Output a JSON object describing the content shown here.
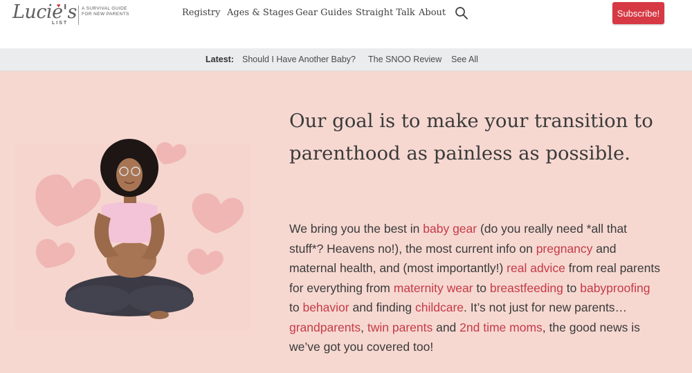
{
  "header": {
    "logo": {
      "script": "Lucie's",
      "list": "LIST",
      "tagline": "A SURVIVAL GUIDE FOR NEW PARENTS"
    },
    "nav": [
      {
        "label": "Registry"
      },
      {
        "label": "Ages & Stages"
      },
      {
        "label": "Gear Guides"
      },
      {
        "label": "Straight Talk"
      },
      {
        "label": "About"
      }
    ],
    "search_icon": "search-icon",
    "subscribe_label": "Subscribe!"
  },
  "latest": {
    "label": "Latest:",
    "links": [
      {
        "label": "Should I Have Another Baby?"
      },
      {
        "label": "The SNOO Review"
      },
      {
        "label": "See All"
      }
    ]
  },
  "hero": {
    "headline": "Our goal is to make your transition to parenthood as painless as possible.",
    "body": {
      "t1": "We bring you the best in ",
      "link_baby_gear": "baby gear",
      "t2": " (do you really need *all that stuff*? Heavens no!), the most current info on ",
      "link_pregnancy": "pregnancy",
      "t3": " and maternal health, and (most importantly!) ",
      "link_real_advice": "real advice",
      "t4": " from real parents for everything from ",
      "link_maternity_wear": "maternity wear",
      "t5": " to ",
      "link_breastfeeding": "breastfeeding",
      "t6": " to ",
      "link_babyproofing": "babyproofing",
      "t7": " to ",
      "link_behavior": "behavior",
      "t8": " and finding ",
      "link_childcare": "childcare",
      "t9": ". It’s not just for new parents… ",
      "link_grandparents": "grandparents",
      "t10": ", ",
      "link_twin_parents": "twin parents",
      "t11": " and ",
      "link_2nd_time_moms": "2nd time moms",
      "t12": ", the good news is we’ve got you covered too!"
    }
  },
  "colors": {
    "brand_red": "#d63943",
    "link_red": "#c63a46",
    "hero_bg": "#f6d8d1",
    "heart_pink": "#f0b6b3",
    "latest_bg": "#ebecee"
  }
}
